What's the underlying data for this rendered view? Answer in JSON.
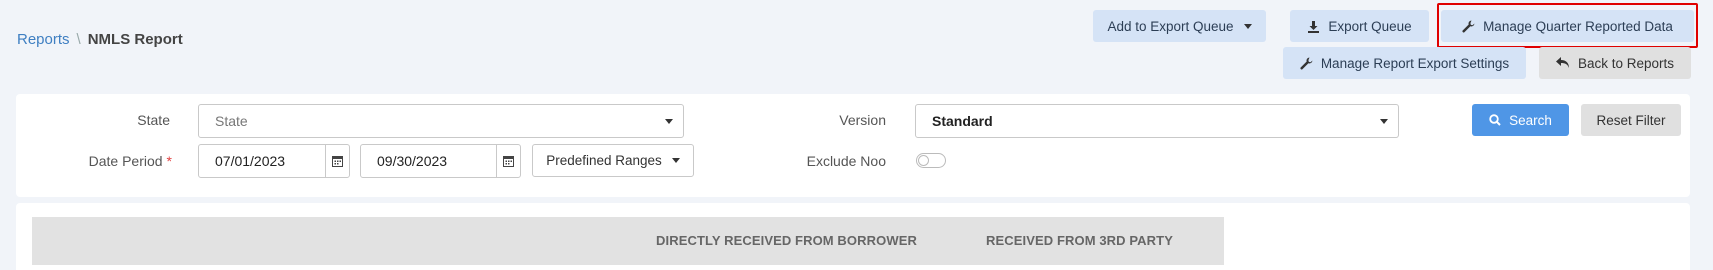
{
  "breadcrumb": {
    "parent": "Reports",
    "separator": "\\",
    "current": "NMLS Report"
  },
  "toolbar": {
    "add_to_export_queue": "Add to Export Queue",
    "export_queue": "Export Queue",
    "manage_quarter_reported_data": "Manage Quarter Reported Data",
    "manage_report_export_settings": "Manage Report Export Settings",
    "back_to_reports": "Back to Reports"
  },
  "filters": {
    "state": {
      "label": "State",
      "placeholder": "State"
    },
    "version": {
      "label": "Version",
      "value": "Standard"
    },
    "date_period": {
      "label": "Date Period",
      "required_mark": "*",
      "start": "07/01/2023",
      "end": "09/30/2023"
    },
    "predefined_ranges": "Predefined Ranges",
    "exclude_noo": {
      "label": "Exclude Noo",
      "checked": false
    },
    "search": "Search",
    "reset_filter": "Reset Filter"
  },
  "table": {
    "headers": [
      "DIRECTLY RECEIVED FROM BORROWER",
      "RECEIVED FROM 3RD PARTY"
    ]
  },
  "colors": {
    "accent": "#4f96e6",
    "highlight": "#e00000"
  }
}
